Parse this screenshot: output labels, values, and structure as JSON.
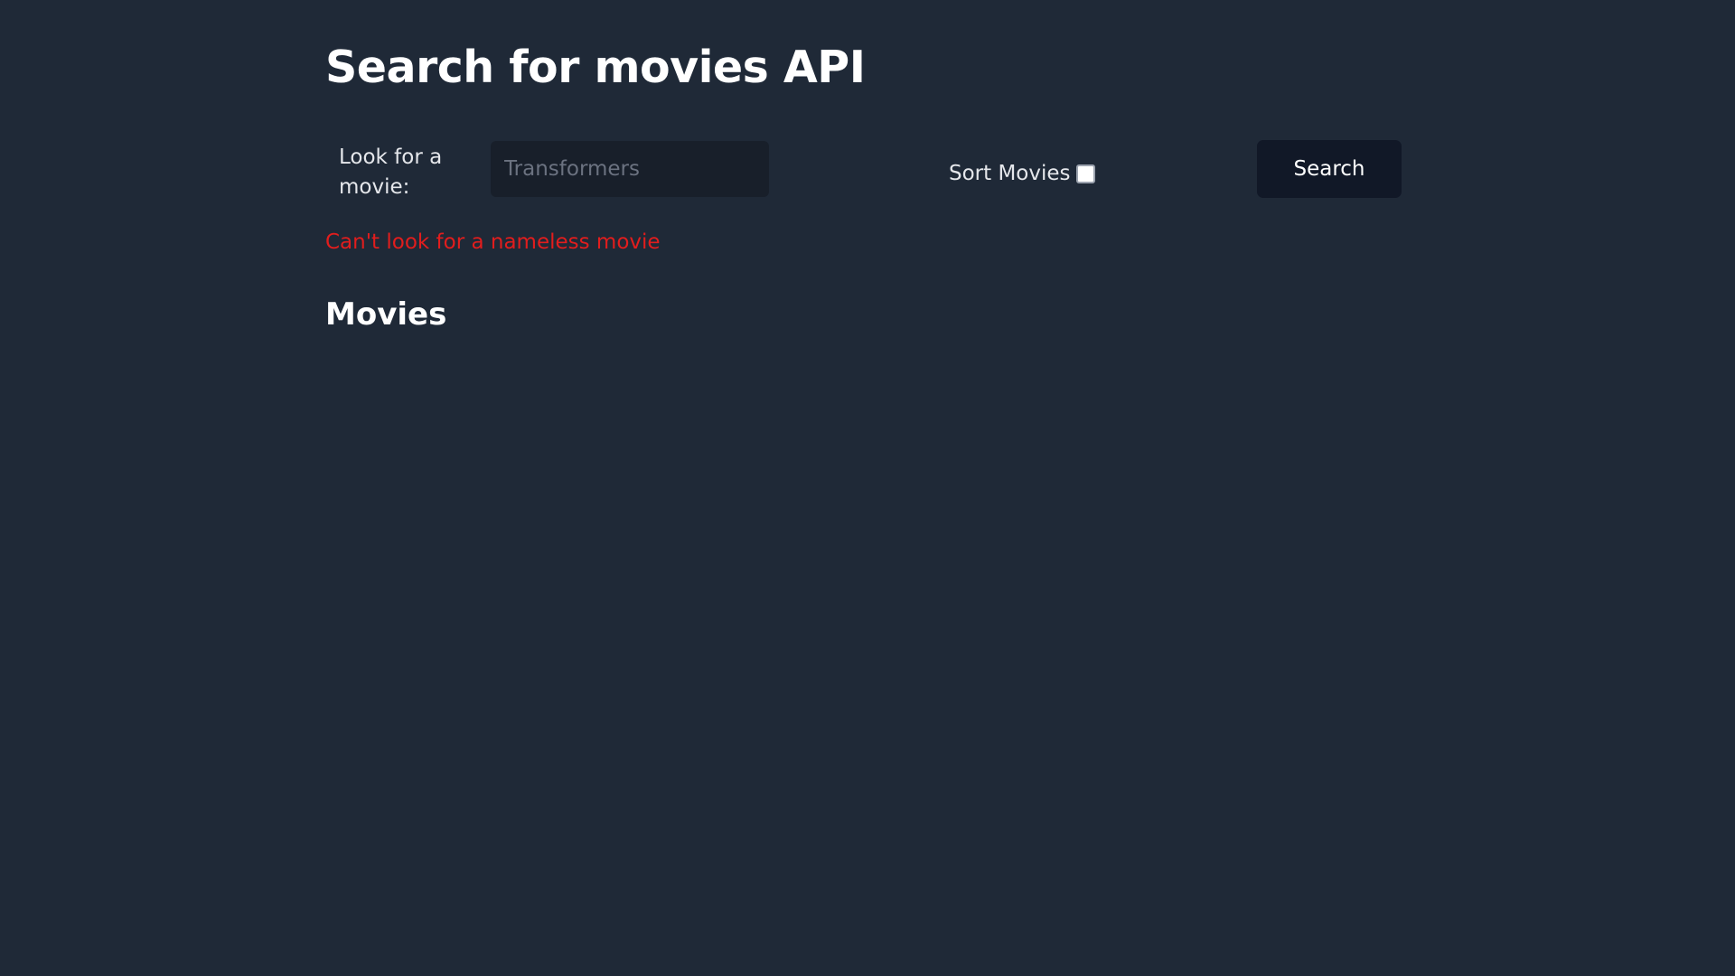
{
  "header": {
    "title": "Search for movies API"
  },
  "search_form": {
    "label": "Look for a movie:",
    "input_placeholder": "Transformers",
    "input_value": "",
    "sort_label": "Sort Movies",
    "sort_checked": false,
    "button_label": "Search"
  },
  "error": {
    "message": "Can't look for a nameless movie"
  },
  "results": {
    "heading": "Movies",
    "items": []
  },
  "colors": {
    "background": "#1f2937",
    "input_background": "#181f2a",
    "button_background": "#111827",
    "error": "#e11d1d",
    "text": "#ffffff"
  }
}
